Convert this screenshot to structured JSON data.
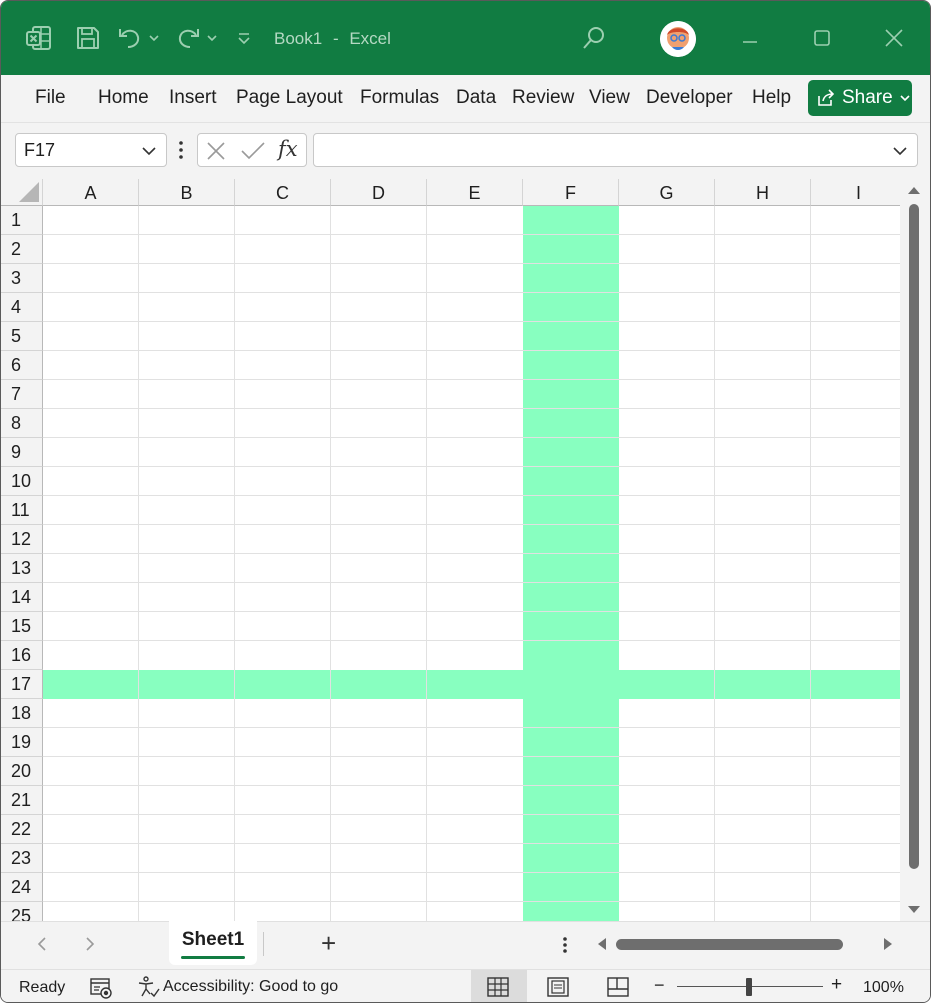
{
  "titlebar": {
    "document_name": "Book1",
    "separator": "-",
    "app_name": "Excel",
    "colors": {
      "background": "#117c42",
      "icon": "#9ccfb0"
    }
  },
  "ribbon": {
    "tabs": [
      "File",
      "Home",
      "Insert",
      "Page Layout",
      "Formulas",
      "Data",
      "Review",
      "View",
      "Developer",
      "Help"
    ],
    "share_label": "Share"
  },
  "formula_bar": {
    "name_box": "F17",
    "cancel_icon": "close-icon",
    "enter_icon": "check-icon",
    "function_label": "fx",
    "formula_value": ""
  },
  "grid": {
    "columns": [
      "A",
      "B",
      "C",
      "D",
      "E",
      "F",
      "G",
      "H",
      "I"
    ],
    "rows": [
      "1",
      "2",
      "3",
      "4",
      "5",
      "6",
      "7",
      "8",
      "9",
      "10",
      "11",
      "12",
      "13",
      "14",
      "15",
      "16",
      "17",
      "18",
      "19",
      "20",
      "21",
      "22",
      "23",
      "24",
      "25"
    ],
    "active_cell": "F17",
    "highlight_column": "F",
    "highlight_row": "17",
    "highlight_color": "#88ffc0"
  },
  "sheets": {
    "tabs": [
      "Sheet1"
    ],
    "active": "Sheet1",
    "add_label": "+"
  },
  "statusbar": {
    "ready": "Ready",
    "accessibility": "Accessibility: Good to go",
    "zoom": "100%",
    "zoom_minus": "−",
    "zoom_plus": "+"
  }
}
